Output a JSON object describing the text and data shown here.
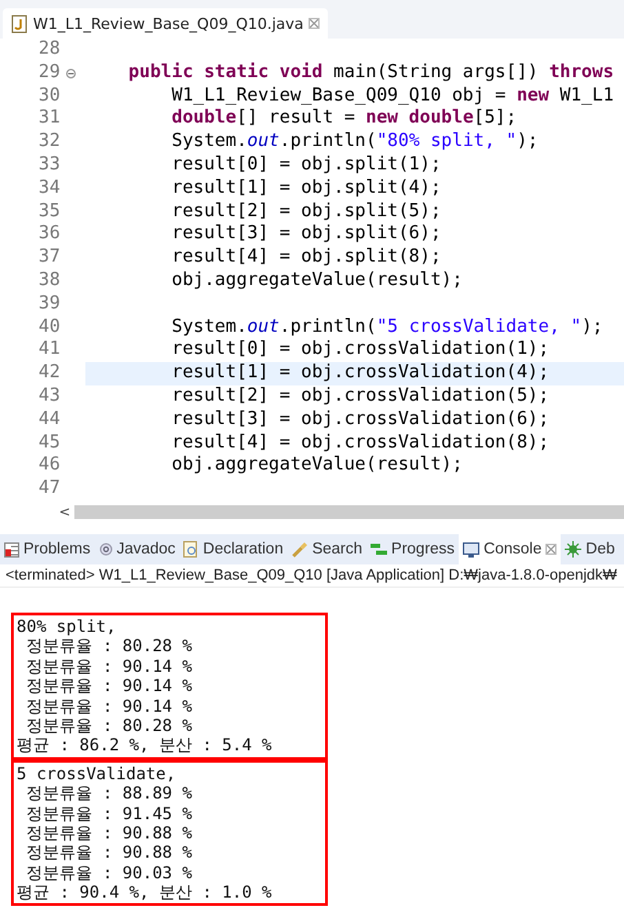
{
  "editor": {
    "tab": {
      "title": "W1_L1_Review_Base_Q09_Q10.java"
    },
    "lines": [
      {
        "number": "28",
        "fold": false,
        "current": false
      },
      {
        "number": "29",
        "fold": true,
        "current": false,
        "tokens": [
          {
            "kind": "kw",
            "text": "    public static void"
          },
          {
            "kind": "plain",
            "text": " main(String args[]) "
          },
          {
            "kind": "kw",
            "text": "throws"
          }
        ]
      },
      {
        "number": "30",
        "fold": false,
        "current": false,
        "tokens": [
          {
            "kind": "plain",
            "text": "        W1_L1_Review_Base_Q09_Q10 obj = "
          },
          {
            "kind": "kw",
            "text": "new"
          },
          {
            "kind": "plain",
            "text": " W1_L1"
          }
        ]
      },
      {
        "number": "31",
        "fold": false,
        "current": false,
        "tokens": [
          {
            "kind": "kw",
            "text": "        double"
          },
          {
            "kind": "plain",
            "text": "[] result = "
          },
          {
            "kind": "kw",
            "text": "new double"
          },
          {
            "kind": "plain",
            "text": "[5];"
          }
        ]
      },
      {
        "number": "32",
        "fold": false,
        "current": false,
        "tokens": [
          {
            "kind": "plain",
            "text": "        System."
          },
          {
            "kind": "field",
            "text": "out"
          },
          {
            "kind": "plain",
            "text": ".println("
          },
          {
            "kind": "str",
            "text": "\"80% split, \""
          },
          {
            "kind": "plain",
            "text": ");"
          }
        ]
      },
      {
        "number": "33",
        "fold": false,
        "current": false,
        "tokens": [
          {
            "kind": "plain",
            "text": "        result[0] = obj.split(1);"
          }
        ]
      },
      {
        "number": "34",
        "fold": false,
        "current": false,
        "tokens": [
          {
            "kind": "plain",
            "text": "        result[1] = obj.split(4);"
          }
        ]
      },
      {
        "number": "35",
        "fold": false,
        "current": false,
        "tokens": [
          {
            "kind": "plain",
            "text": "        result[2] = obj.split(5);"
          }
        ]
      },
      {
        "number": "36",
        "fold": false,
        "current": false,
        "tokens": [
          {
            "kind": "plain",
            "text": "        result[3] = obj.split(6);"
          }
        ]
      },
      {
        "number": "37",
        "fold": false,
        "current": false,
        "tokens": [
          {
            "kind": "plain",
            "text": "        result[4] = obj.split(8);"
          }
        ]
      },
      {
        "number": "38",
        "fold": false,
        "current": false,
        "tokens": [
          {
            "kind": "plain",
            "text": "        obj.aggregateValue(result);"
          }
        ]
      },
      {
        "number": "39",
        "fold": false,
        "current": false
      },
      {
        "number": "40",
        "fold": false,
        "current": false,
        "tokens": [
          {
            "kind": "plain",
            "text": "        System."
          },
          {
            "kind": "field",
            "text": "out"
          },
          {
            "kind": "plain",
            "text": ".println("
          },
          {
            "kind": "str",
            "text": "\"5 crossValidate, \""
          },
          {
            "kind": "plain",
            "text": ");"
          }
        ]
      },
      {
        "number": "41",
        "fold": false,
        "current": false,
        "tokens": [
          {
            "kind": "plain",
            "text": "        result[0] = obj.crossValidation(1);"
          }
        ]
      },
      {
        "number": "42",
        "fold": false,
        "current": true,
        "tokens": [
          {
            "kind": "plain",
            "text": "        result[1] = obj.crossValidation(4);"
          }
        ]
      },
      {
        "number": "43",
        "fold": false,
        "current": false,
        "tokens": [
          {
            "kind": "plain",
            "text": "        result[2] = obj.crossValidation(5);"
          }
        ]
      },
      {
        "number": "44",
        "fold": false,
        "current": false,
        "tokens": [
          {
            "kind": "plain",
            "text": "        result[3] = obj.crossValidation(6);"
          }
        ]
      },
      {
        "number": "45",
        "fold": false,
        "current": false,
        "tokens": [
          {
            "kind": "plain",
            "text": "        result[4] = obj.crossValidation(8);"
          }
        ]
      },
      {
        "number": "46",
        "fold": false,
        "current": false,
        "tokens": [
          {
            "kind": "plain",
            "text": "        obj.aggregateValue(result);"
          }
        ]
      },
      {
        "number": "47",
        "fold": false,
        "current": false
      }
    ],
    "scroll_arrow": "<"
  },
  "panel": {
    "tabs": [
      {
        "label": "Problems",
        "selected": false
      },
      {
        "label": "Javadoc",
        "selected": false
      },
      {
        "label": "Declaration",
        "selected": false
      },
      {
        "label": "Search",
        "selected": false
      },
      {
        "label": "Progress",
        "selected": false
      },
      {
        "label": "Console",
        "selected": true
      },
      {
        "label": "Deb",
        "selected": false
      }
    ],
    "status": "<terminated> W1_L1_Review_Base_Q09_Q10 [Java Application] D:₩java-1.8.0-openjdk₩",
    "output_groups": [
      {
        "lines": [
          "80% split,",
          " 정분류율 : 80.28 %",
          " 정분류율 : 90.14 %",
          " 정분류율 : 90.14 %",
          " 정분류율 : 90.14 %",
          " 정분류율 : 80.28 %",
          "평균 : 86.2 %, 분산 : 5.4 %"
        ]
      },
      {
        "lines": [
          "5 crossValidate,",
          " 정분류율 : 88.89 %",
          " 정분류율 : 91.45 %",
          " 정분류율 : 90.88 %",
          " 정분류율 : 90.88 %",
          " 정분류율 : 90.03 %",
          "평균 : 90.4 %, 분산 : 1.0 %"
        ]
      }
    ]
  }
}
